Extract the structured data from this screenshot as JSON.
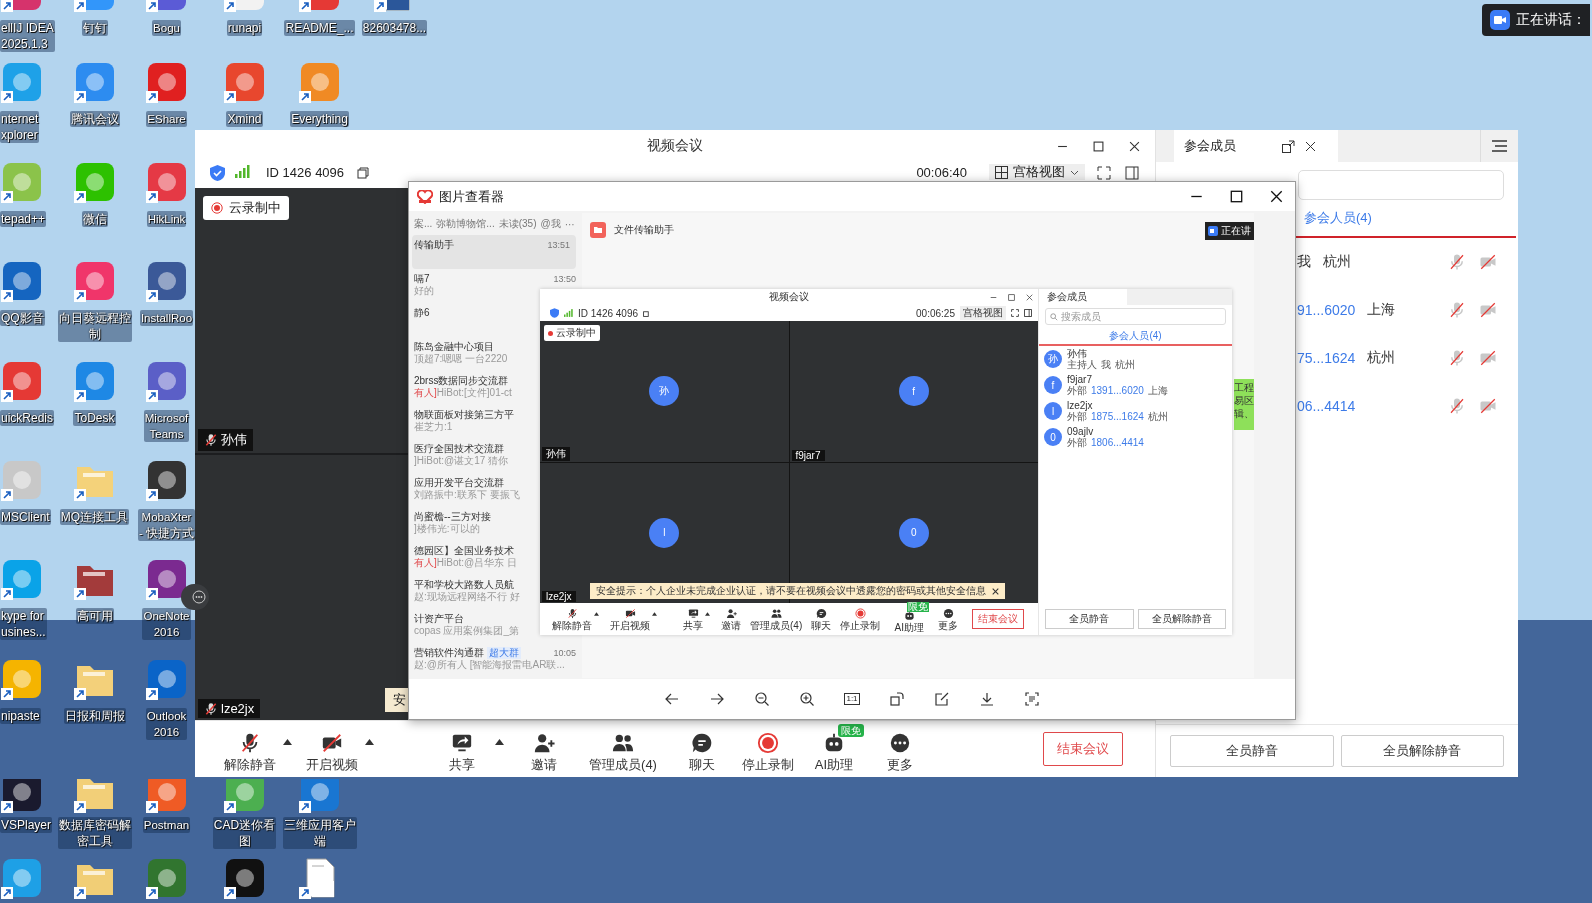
{
  "desktop": {
    "icon_rows": [
      [
        {
          "lines": [
            "ellIJ IDEA",
            "2025.1.3"
          ],
          "kind": "app",
          "color": "#d6336c"
        },
        {
          "lines": [
            "钉钉"
          ],
          "kind": "app",
          "color": "#3296fa"
        },
        {
          "lines": [
            "Bogu"
          ],
          "kind": "app",
          "color": "#5b5bd6"
        },
        {
          "lines": [
            "runapi"
          ],
          "kind": "app",
          "color": "#f2f2f2"
        },
        {
          "lines": [
            "README_..."
          ],
          "kind": "app",
          "color": "#e53935"
        },
        {
          "lines": [
            "82603478..."
          ],
          "kind": "doc",
          "color": "#2b579a"
        }
      ],
      [
        {
          "lines": [
            "nternet",
            "xplorer"
          ],
          "kind": "app",
          "color": "#1ea1e8"
        },
        {
          "lines": [
            "腾讯会议"
          ],
          "kind": "app",
          "color": "#2d8cf0"
        },
        {
          "lines": [
            "EShare"
          ],
          "kind": "app",
          "color": "#e02020"
        },
        {
          "lines": [
            "Xmind"
          ],
          "kind": "app",
          "color": "#e8472e"
        },
        {
          "lines": [
            "Everything"
          ],
          "kind": "app",
          "color": "#f08a24"
        }
      ],
      [
        {
          "lines": [
            "tepad++"
          ],
          "kind": "app",
          "color": "#8bc34a"
        },
        {
          "lines": [
            "微信"
          ],
          "kind": "app",
          "color": "#2dc100"
        },
        {
          "lines": [
            "HikLink"
          ],
          "kind": "app",
          "color": "#e53945"
        }
      ],
      [
        {
          "lines": [
            "QQ影音"
          ],
          "kind": "app",
          "color": "#1565c0"
        },
        {
          "lines": [
            "向日葵远程控",
            "制"
          ],
          "kind": "app",
          "color": "#f0356a"
        },
        {
          "lines": [
            "InstallRoo"
          ],
          "kind": "app",
          "color": "#3b5998"
        }
      ],
      [
        {
          "lines": [
            "uickRedis"
          ],
          "kind": "app",
          "color": "#e53935"
        },
        {
          "lines": [
            "ToDesk"
          ],
          "kind": "app",
          "color": "#1e88e5"
        },
        {
          "lines": [
            "Microsof",
            "Teams"
          ],
          "kind": "app",
          "color": "#5b5fc7"
        }
      ],
      [
        {
          "lines": [
            "MSClient"
          ],
          "kind": "app",
          "color": "#c8c8c8"
        },
        {
          "lines": [
            "MQ连接工具"
          ],
          "kind": "folder",
          "color": "#f4d27a"
        },
        {
          "lines": [
            "MobaXter",
            "- 快捷方式"
          ],
          "kind": "app",
          "color": "#333333"
        }
      ],
      [
        {
          "lines": [
            "kype for",
            "usines..."
          ],
          "kind": "app",
          "color": "#0aa3e8"
        },
        {
          "lines": [
            "高可用"
          ],
          "kind": "folder",
          "color": "#a33b3b"
        },
        {
          "lines": [
            "OneNote",
            "2016"
          ],
          "kind": "app",
          "color": "#7b2a90"
        }
      ],
      [
        {
          "lines": [
            "nipaste"
          ],
          "kind": "app",
          "color": "#f5b400"
        },
        {
          "lines": [
            "日报和周报"
          ],
          "kind": "folder",
          "color": "#f3d07a"
        },
        {
          "lines": [
            "Outlook",
            "2016"
          ],
          "kind": "app",
          "color": "#0a64c8"
        }
      ],
      [
        {
          "lines": [
            "VSPlayer"
          ],
          "kind": "app",
          "color": "#1a1a2e"
        },
        {
          "lines": [
            "数据库密码解",
            "密工具"
          ],
          "kind": "folder",
          "color": "#f2cf78"
        },
        {
          "lines": [
            "Postman"
          ],
          "kind": "app",
          "color": "#ef5b25"
        },
        {
          "lines": [
            "CAD迷你看",
            "图"
          ],
          "kind": "app",
          "color": "#4caf50"
        },
        {
          "lines": [
            "三维应用客户",
            "端"
          ],
          "kind": "app",
          "color": "#1976d2"
        }
      ],
      [
        {
          "kind": "app",
          "color": "#1ea0e6"
        },
        {
          "kind": "folder",
          "color": "#f1ce76"
        },
        {
          "kind": "app",
          "color": "#31752f"
        },
        {
          "kind": "app",
          "color": "#111111"
        },
        {
          "kind": "doc",
          "color": "#ffffff"
        }
      ]
    ]
  },
  "speaking_indicator": "正在讲话：",
  "meeting_window": {
    "title": "视频会议",
    "meeting_id": "ID 1426 4096",
    "timer": "00:06:40",
    "view_mode": "宫格视图",
    "recording_badge": "云录制中",
    "tiles": [
      {
        "name": "孙伟",
        "muted": true
      },
      {
        "name": "lze2jx",
        "muted": true
      }
    ],
    "notice_fragment": "安",
    "toolbar": [
      {
        "label": "解除静音",
        "kind": "mic-muted",
        "menu": true
      },
      {
        "label": "开启视频",
        "kind": "camera-off",
        "menu": true
      },
      {
        "label": "共享",
        "kind": "share",
        "menu": true
      },
      {
        "label": "邀请",
        "kind": "invite",
        "menu": false
      },
      {
        "label": "管理成员(4)",
        "kind": "members",
        "menu": false
      },
      {
        "label": "聊天",
        "kind": "chat",
        "menu": false
      },
      {
        "label": "停止录制",
        "kind": "record",
        "menu": false
      },
      {
        "label": "AI助理",
        "kind": "ai",
        "menu": false,
        "badge": "限免"
      },
      {
        "label": "更多",
        "kind": "more",
        "menu": false
      }
    ],
    "end_button": "结束会议"
  },
  "members_panel": {
    "tab": "参会成员",
    "list_tab": "参会人员(4)",
    "members": [
      {
        "tag": "我",
        "location": "杭州",
        "mic_muted": true,
        "camera_off": true
      },
      {
        "phone": "91...6020",
        "location": "上海",
        "mic_muted": true,
        "camera_off": true
      },
      {
        "phone": "75...1624",
        "location": "杭州",
        "mic_muted": true,
        "camera_off": true
      },
      {
        "phone": "06...4414",
        "mic_muted": true,
        "camera_off": true
      }
    ],
    "buttons": [
      "全员静音",
      "全员解除静音"
    ]
  },
  "image_viewer": {
    "title": "图片查看器",
    "toolbar": [
      {
        "kind": "prev"
      },
      {
        "kind": "next"
      },
      {
        "kind": "zoom-out"
      },
      {
        "kind": "zoom-in"
      },
      {
        "kind": "actual-size",
        "label": "1:1"
      },
      {
        "kind": "rotate"
      },
      {
        "kind": "edit"
      },
      {
        "kind": "download"
      },
      {
        "kind": "ocr"
      }
    ],
    "image": {
      "chat_filters": [
        "案...",
        "弥勒博物馆...",
        "未读(35)",
        "@我",
        "···"
      ],
      "chats": [
        {
          "title": "传输助手",
          "time": "13:51",
          "selected": true
        },
        {
          "title": "嗝7",
          "preview": "好的",
          "time": "13:50",
          "selected": false
        },
        {
          "title": "静6",
          "selected": false
        },
        {
          "title": "陈岛金融中心项目",
          "preview": "顶超7:嗯嗯 一台2220",
          "selected": false
        },
        {
          "title": "2brss数据同步交流群",
          "alert": "有人]",
          "preview": "HiBot:[文件]01-ct",
          "selected": false
        },
        {
          "title": "物联面板对接第三方平",
          "preview": "崔芝力:1",
          "selected": false
        },
        {
          "title": "医疗全国技术交流群",
          "preview": "]HiBot:@谌文17 猜你",
          "selected": false
        },
        {
          "title": "应用开发平台交流群",
          "preview": "刘路振中:联系下 要振飞",
          "selected": false
        },
        {
          "title": "尚蜜檐--三方对接",
          "preview": "]楼伟光:可以的",
          "selected": false
        },
        {
          "title": "德园区】全国业务技术",
          "alert": "有人]",
          "preview": "HiBot:@吕华东 日",
          "selected": false
        },
        {
          "title": "平和学校大路数人员航",
          "preview": "赵:现场远程网络不行 好",
          "selected": false
        },
        {
          "title": "计资产平台",
          "preview": "copas 应用案例集团_第",
          "selected": false
        },
        {
          "title": "营销软件沟通群",
          "badge": "超大群",
          "preview": "赵:@所有人 [智能海报雷电AR联...",
          "time": "10:05",
          "selected": false
        }
      ],
      "conversation_title": "文件传输助手",
      "speaking_badge": "正在讲",
      "side_note": [
        "工程",
        "易区",
        "辑、"
      ],
      "meeting": {
        "title": "视频会议",
        "meeting_id": "ID 1426 4096",
        "timer": "00:06:25",
        "view_mode": "宫格视图",
        "recording_badge": "云录制中",
        "tiles": [
          {
            "avatar": "孙",
            "name": "孙伟"
          },
          {
            "avatar": "f",
            "name": "f9jar7"
          },
          {
            "avatar": "l",
            "name": "lze2jx"
          },
          {
            "avatar": "0"
          }
        ],
        "notice": "安全提示：个人企业未完成企业认证，请不要在视频会议中透露您的密码或其他安全信息",
        "toolbar": [
          {
            "label": "解除静音",
            "kind": "mic-muted",
            "menu": true
          },
          {
            "label": "开启视频",
            "kind": "camera-off",
            "menu": true
          },
          {
            "label": "共享",
            "kind": "share",
            "menu": true
          },
          {
            "label": "邀请",
            "kind": "invite",
            "menu": false
          },
          {
            "label": "管理成员(4)",
            "kind": "members",
            "menu": false
          },
          {
            "label": "聊天",
            "kind": "chat",
            "menu": false
          },
          {
            "label": "停止录制",
            "kind": "record",
            "menu": false
          },
          {
            "label": "AI助理",
            "kind": "ai",
            "menu": false,
            "badge": "限免"
          },
          {
            "label": "更多",
            "kind": "more",
            "menu": false
          }
        ],
        "end_button": "结束会议",
        "members_panel": {
          "tab": "参会成员",
          "search_placeholder": "搜索成员",
          "list_tab": "参会人员(4)",
          "members": [
            {
              "avatar": "孙",
              "name": "孙伟",
              "tags": [
                "主持人",
                "我"
              ],
              "location": "杭州"
            },
            {
              "avatar": "f",
              "name": "f9jar7",
              "tags": [
                "外部"
              ],
              "phone": "1391...6020",
              "location": "上海"
            },
            {
              "avatar": "l",
              "name": "lze2jx",
              "tags": [
                "外部"
              ],
              "phone": "1875...1624",
              "location": "杭州"
            },
            {
              "avatar": "0",
              "name": "09ajlv",
              "tags": [
                "外部"
              ],
              "phone": "1806...4414"
            }
          ],
          "buttons": [
            "全员静音",
            "全员解除静音"
          ]
        }
      }
    }
  }
}
